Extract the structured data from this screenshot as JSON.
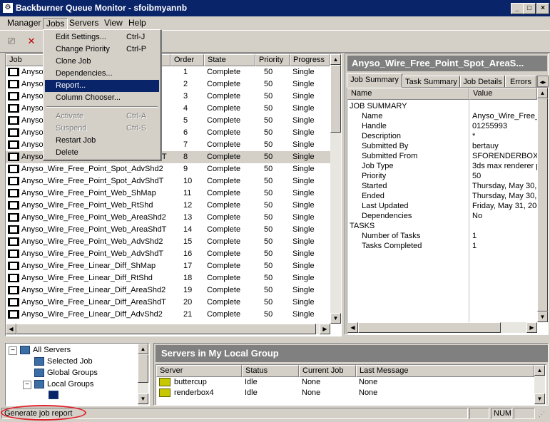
{
  "window": {
    "title": "Backburner Queue Monitor - sfoibmyannb",
    "app_icon": "app-icon",
    "controls": [
      "_",
      "□",
      "×"
    ]
  },
  "menubar": [
    "Manager",
    "Jobs",
    "Servers",
    "View",
    "Help"
  ],
  "jobs_menu": {
    "items": [
      {
        "label": "Edit Settings...",
        "shortcut": "Ctrl-J",
        "state": "normal"
      },
      {
        "label": "Change Priority",
        "shortcut": "Ctrl-P",
        "state": "normal"
      },
      {
        "label": "Clone Job",
        "shortcut": "",
        "state": "normal"
      },
      {
        "label": "Dependencies...",
        "shortcut": "",
        "state": "normal"
      },
      {
        "label": "Report...",
        "shortcut": "",
        "state": "selected"
      },
      {
        "label": "Column Chooser...",
        "shortcut": "",
        "state": "normal"
      },
      {
        "label": "Activate",
        "shortcut": "Ctrl-A",
        "state": "disabled"
      },
      {
        "label": "Suspend",
        "shortcut": "Ctrl-S",
        "state": "disabled"
      },
      {
        "label": "Restart Job",
        "shortcut": "",
        "state": "normal"
      },
      {
        "label": "Delete",
        "shortcut": "",
        "state": "normal"
      }
    ]
  },
  "job_table": {
    "columns": [
      "Job",
      "Order",
      "State",
      "Priority",
      "Progress"
    ],
    "rows": [
      {
        "job": "Anyso",
        "order": "1",
        "state": "Complete",
        "priority": "50",
        "progress": "Single"
      },
      {
        "job": "Anyso",
        "order": "2",
        "state": "Complete",
        "priority": "50",
        "progress": "Single"
      },
      {
        "job": "Anyso",
        "order": "3",
        "state": "Complete",
        "priority": "50",
        "progress": "Single"
      },
      {
        "job": "Anyso",
        "order": "4",
        "state": "Complete",
        "priority": "50",
        "progress": "Single"
      },
      {
        "job": "Anyso",
        "order": "5",
        "state": "Complete",
        "priority": "50",
        "progress": "Single"
      },
      {
        "job": "Anyso",
        "order": "6",
        "state": "Complete",
        "priority": "50",
        "progress": "Single"
      },
      {
        "job": "Anyso",
        "order": "7",
        "state": "Complete",
        "priority": "50",
        "progress": "Single"
      },
      {
        "job": "Anyso_Wire_Free_Point_Spot_AreaShdT",
        "order": "8",
        "state": "Complete",
        "priority": "50",
        "progress": "Single",
        "selected": true
      },
      {
        "job": "Anyso_Wire_Free_Point_Spot_AdvShd2",
        "order": "9",
        "state": "Complete",
        "priority": "50",
        "progress": "Single"
      },
      {
        "job": "Anyso_Wire_Free_Point_Spot_AdvShdT",
        "order": "10",
        "state": "Complete",
        "priority": "50",
        "progress": "Single"
      },
      {
        "job": "Anyso_Wire_Free_Point_Web_ShMap",
        "order": "11",
        "state": "Complete",
        "priority": "50",
        "progress": "Single"
      },
      {
        "job": "Anyso_Wire_Free_Point_Web_RtShd",
        "order": "12",
        "state": "Complete",
        "priority": "50",
        "progress": "Single"
      },
      {
        "job": "Anyso_Wire_Free_Point_Web_AreaShd2",
        "order": "13",
        "state": "Complete",
        "priority": "50",
        "progress": "Single"
      },
      {
        "job": "Anyso_Wire_Free_Point_Web_AreaShdT",
        "order": "14",
        "state": "Complete",
        "priority": "50",
        "progress": "Single"
      },
      {
        "job": "Anyso_Wire_Free_Point_Web_AdvShd2",
        "order": "15",
        "state": "Complete",
        "priority": "50",
        "progress": "Single"
      },
      {
        "job": "Anyso_Wire_Free_Point_Web_AdvShdT",
        "order": "16",
        "state": "Complete",
        "priority": "50",
        "progress": "Single"
      },
      {
        "job": "Anyso_Wire_Free_Linear_Diff_ShMap",
        "order": "17",
        "state": "Complete",
        "priority": "50",
        "progress": "Single"
      },
      {
        "job": "Anyso_Wire_Free_Linear_Diff_RtShd",
        "order": "18",
        "state": "Complete",
        "priority": "50",
        "progress": "Single"
      },
      {
        "job": "Anyso_Wire_Free_Linear_Diff_AreaShd2",
        "order": "19",
        "state": "Complete",
        "priority": "50",
        "progress": "Single"
      },
      {
        "job": "Anyso_Wire_Free_Linear_Diff_AreaShdT",
        "order": "20",
        "state": "Complete",
        "priority": "50",
        "progress": "Single"
      },
      {
        "job": "Anyso_Wire_Free_Linear_Diff_AdvShd2",
        "order": "21",
        "state": "Complete",
        "priority": "50",
        "progress": "Single"
      }
    ]
  },
  "job_panel": {
    "title": "Anyso_Wire_Free_Point_Spot_AreaS...",
    "tabs": [
      "Job Summary",
      "Task Summary",
      "Job Details",
      "Errors"
    ],
    "active_tab": "Job Summary",
    "columns": [
      "Name",
      "Value"
    ],
    "rows": [
      {
        "name": "JOB SUMMARY",
        "value": "",
        "section": true
      },
      {
        "name": "Name",
        "value": "Anyso_Wire_Free_Po"
      },
      {
        "name": "Handle",
        "value": "01255993"
      },
      {
        "name": "Description",
        "value": "*"
      },
      {
        "name": "Submitted By",
        "value": "bertauy"
      },
      {
        "name": "Submitted From",
        "value": "SFORENDERBOXX"
      },
      {
        "name": "Job Type",
        "value": "3ds max renderer plu"
      },
      {
        "name": "Priority",
        "value": "50"
      },
      {
        "name": "Started",
        "value": "Thursday, May 30, 20"
      },
      {
        "name": "Ended",
        "value": "Thursday, May 30, 20"
      },
      {
        "name": "Last Updated",
        "value": "Friday, May 31, 2002"
      },
      {
        "name": "Dependencies",
        "value": "No"
      },
      {
        "name": "TASKS",
        "value": "",
        "section": true
      },
      {
        "name": "Number of Tasks",
        "value": "1"
      },
      {
        "name": "Tasks Completed",
        "value": "1"
      }
    ]
  },
  "tree": {
    "items": [
      {
        "label": "All Servers",
        "level": 0,
        "expander": "−"
      },
      {
        "label": "Selected Job",
        "level": 1,
        "expander": ""
      },
      {
        "label": "Global Groups",
        "level": 1,
        "expander": ""
      },
      {
        "label": "Local Groups",
        "level": 1,
        "expander": "−"
      }
    ]
  },
  "servers_panel": {
    "title": "Servers in My Local Group",
    "columns": [
      "Server",
      "Status",
      "Current Job",
      "Last Message"
    ],
    "rows": [
      {
        "server": "buttercup",
        "status": "Idle",
        "current_job": "None",
        "last_message": "None"
      },
      {
        "server": "renderbox4",
        "status": "Idle",
        "current_job": "None",
        "last_message": "None"
      }
    ]
  },
  "statusbar": {
    "message": "Generate job report",
    "num": "NUM"
  },
  "colors": {
    "titlebar": "#0a246a",
    "selection": "#0a246a",
    "panel_header": "#808080",
    "annotation": "#e0202a"
  }
}
